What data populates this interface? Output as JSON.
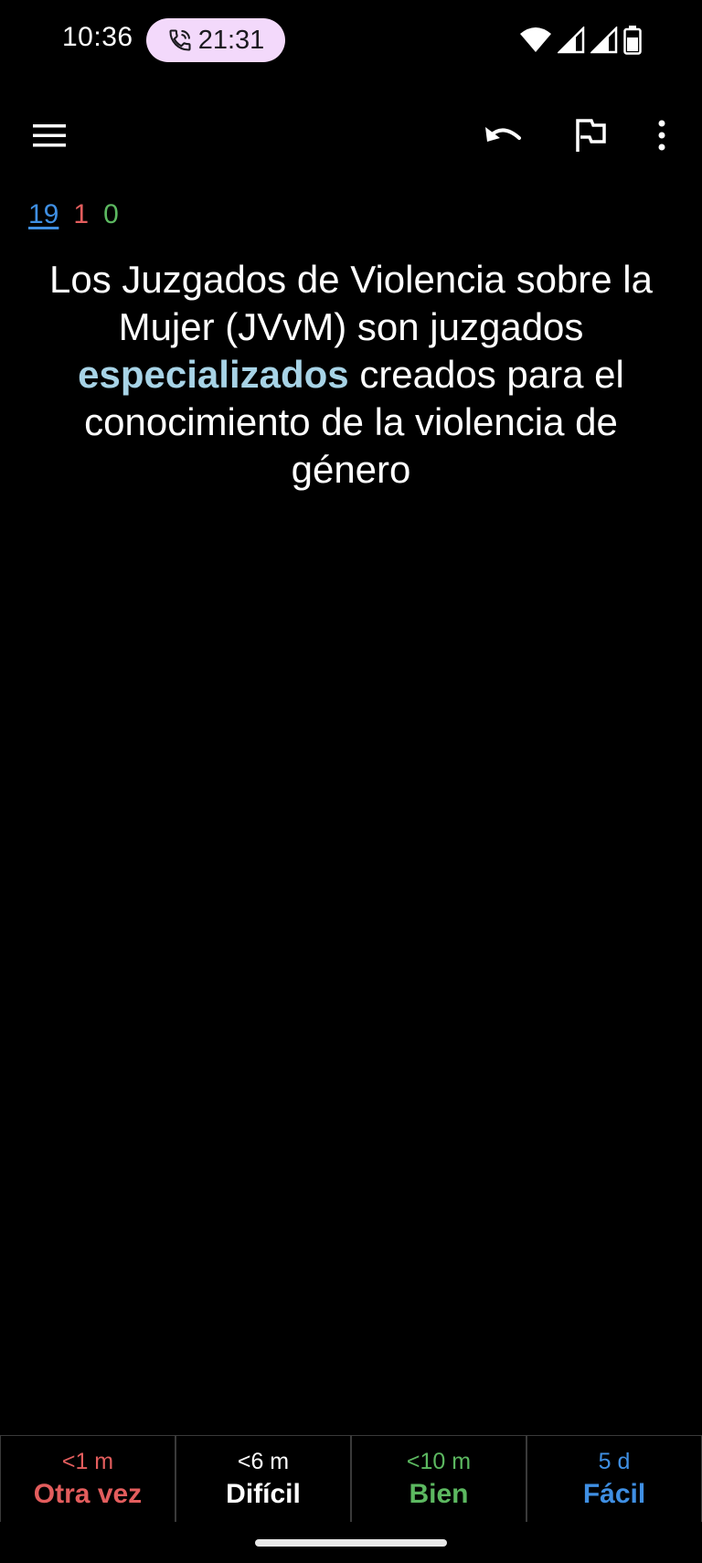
{
  "status_bar": {
    "time": "10:36",
    "call_timer": "21:31",
    "icons": [
      "phone-call-icon",
      "wifi-icon",
      "signal-icon",
      "signal-icon",
      "battery-icon"
    ]
  },
  "toolbar": {
    "icons": [
      "menu-icon",
      "undo-icon",
      "flag-icon",
      "more-vert-icon"
    ]
  },
  "counts": {
    "new": "19",
    "learning": "1",
    "review": "0",
    "colors": {
      "new": "#3f8fe3",
      "learning": "#e35d5d",
      "review": "#5cb860"
    }
  },
  "card": {
    "text_before": "Los Juzgados de Violencia sobre la Mujer (JVvM) son juzgados",
    "highlight": "especializados",
    "text_after": "creados para el conocimiento de la violencia de género",
    "highlight_color": "#a7d3e6"
  },
  "answers": [
    {
      "interval": "<1 m",
      "label": "Otra vez",
      "color": "#e35d5d"
    },
    {
      "interval": "<6 m",
      "label": "Difícil",
      "color": "#ffffff"
    },
    {
      "interval": "<10 m",
      "label": "Bien",
      "color": "#5cb860"
    },
    {
      "interval": "5 d",
      "label": "Fácil",
      "color": "#3f8fe3"
    }
  ]
}
